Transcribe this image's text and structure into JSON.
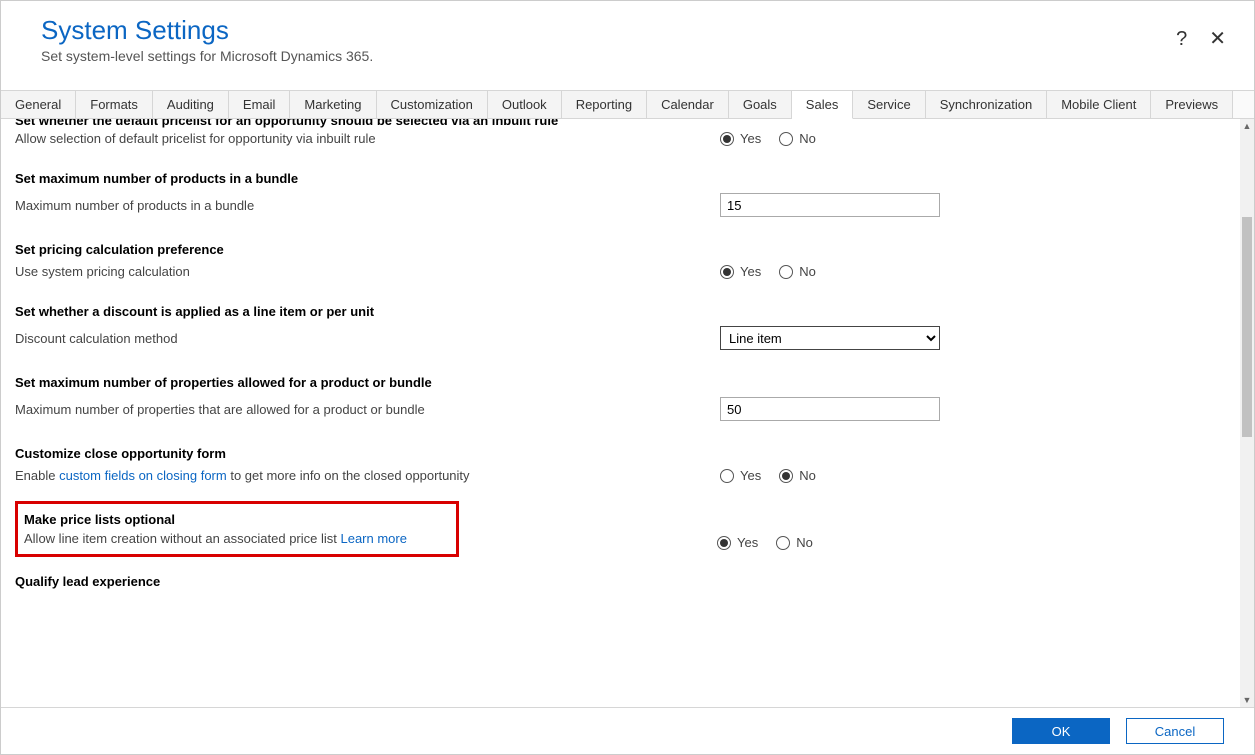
{
  "header": {
    "title": "System Settings",
    "subtitle": "Set system-level settings for Microsoft Dynamics 365."
  },
  "tabs": [
    "General",
    "Formats",
    "Auditing",
    "Email",
    "Marketing",
    "Customization",
    "Outlook",
    "Reporting",
    "Calendar",
    "Goals",
    "Sales",
    "Service",
    "Synchronization",
    "Mobile Client",
    "Previews"
  ],
  "activeTab": "Sales",
  "labels": {
    "yes": "Yes",
    "no": "No"
  },
  "sections": {
    "partialTop": "Set whether the default pricelist for an opportunity should be selected via an inbuilt rule",
    "s0_label": "Allow selection of default pricelist for opportunity via inbuilt rule",
    "s0_value": "Yes",
    "s1_head": "Set maximum number of products in a bundle",
    "s1_label": "Maximum number of products in a bundle",
    "s1_value": "15",
    "s2_head": "Set pricing calculation preference",
    "s2_label": "Use system pricing calculation",
    "s2_value": "Yes",
    "s3_head": "Set whether a discount is applied as a line item or per unit",
    "s3_label": "Discount calculation method",
    "s3_value": "Line item",
    "s4_head": "Set maximum number of properties allowed for a product or bundle",
    "s4_label": "Maximum number of properties that are allowed for a product or bundle",
    "s4_value": "50",
    "s5_head": "Customize close opportunity form",
    "s5_label_pre": "Enable ",
    "s5_link": "custom fields on closing form",
    "s5_label_post": " to get more info on the closed opportunity",
    "s5_value": "No",
    "s6_head": "Make price lists optional",
    "s6_label_pre": "Allow line item creation without an associated price list ",
    "s6_link": "Learn more",
    "s6_value": "Yes",
    "s7_head": "Qualify lead experience"
  },
  "footer": {
    "ok": "OK",
    "cancel": "Cancel"
  }
}
